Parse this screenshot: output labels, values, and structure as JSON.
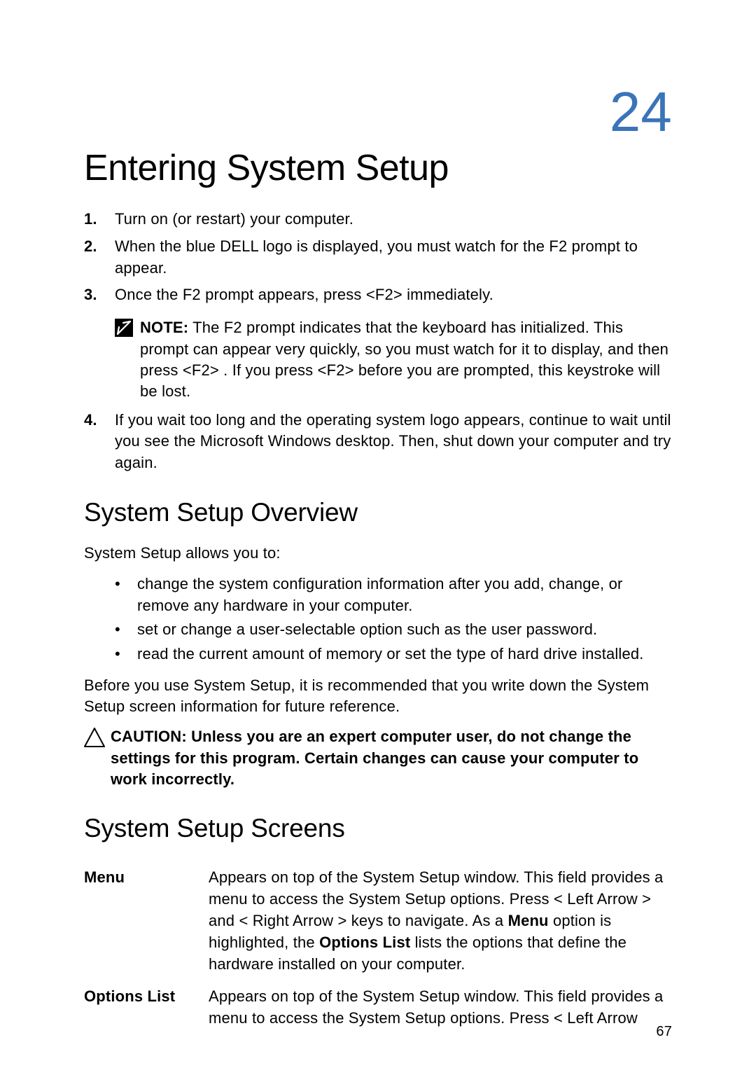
{
  "chapter_number": "24",
  "page_number": "67",
  "title": "Entering System Setup",
  "steps": [
    {
      "num": "1.",
      "text": "Turn on (or restart) your computer."
    },
    {
      "num": "2.",
      "text": "When the blue DELL logo is displayed, you must watch for the F2 prompt to appear."
    },
    {
      "num": "3.",
      "text": "Once the F2 prompt appears, press <F2> immediately."
    },
    {
      "num": "4.",
      "text": "If you wait too long and the operating system logo appears, continue to wait until you see the Microsoft Windows desktop. Then, shut down your computer and try again."
    }
  ],
  "note": {
    "label": "NOTE:",
    "text": " The F2 prompt indicates that the keyboard has initialized. This prompt can appear very quickly, so you must watch for it to display, and then press <F2> . If you press <F2> before you are prompted, this keystroke will be lost."
  },
  "overview": {
    "heading": "System Setup Overview",
    "intro": "System Setup allows you to:",
    "bullets": [
      "change the system configuration information after you add, change, or remove any hardware in your computer.",
      "set or change a user-selectable option such as the user password.",
      "read the current amount of memory or set the type of hard drive installed."
    ],
    "closing": "Before you use System Setup, it is recommended that you write down the System Setup screen information for future reference."
  },
  "caution": {
    "label": "CAUTION:",
    "text": " Unless you are an expert computer user, do not change the settings for this program. Certain changes can cause your computer to work incorrectly."
  },
  "screens": {
    "heading": "System Setup Screens",
    "definitions": [
      {
        "term": "Menu",
        "pre": "Appears on top of the System Setup window. This field provides a menu to access the System Setup options. Press < Left Arrow > and < Right Arrow > keys to navigate. As a ",
        "bold1": "Menu",
        "mid": " option is highlighted, the ",
        "bold2": "Options List",
        "post": " lists the options that define the hardware installed on your computer."
      },
      {
        "term": "Options List",
        "text": "Appears on top of the System Setup window. This field provides a menu to access the System Setup options. Press < Left Arrow"
      }
    ]
  }
}
